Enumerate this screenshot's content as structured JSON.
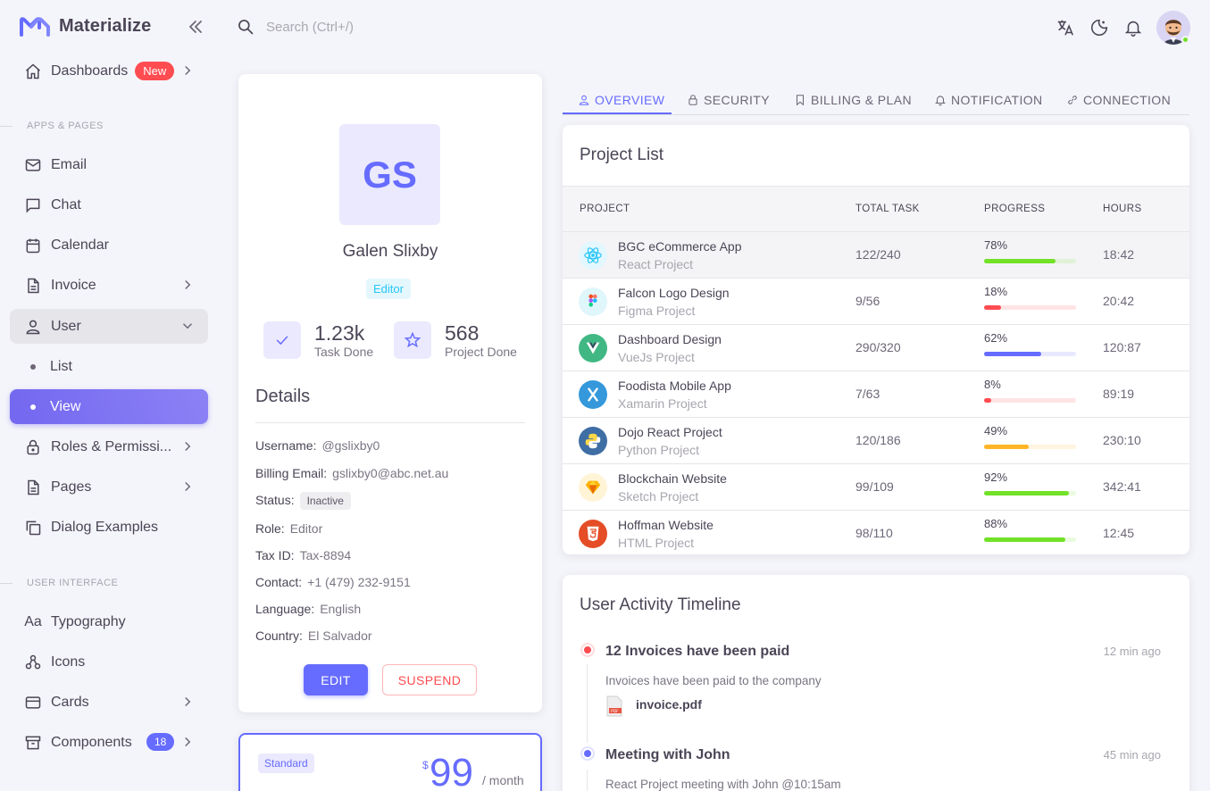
{
  "brand": {
    "name": "Materialize",
    "accent": "#666cff"
  },
  "search": {
    "placeholder": "Search (Ctrl+/)"
  },
  "sidebar": {
    "dashboards": {
      "label": "Dashboards",
      "badge": "New"
    },
    "section_apps": "APPS & PAGES",
    "email": "Email",
    "chat": "Chat",
    "calendar": "Calendar",
    "invoice": "Invoice",
    "user": "User",
    "list": "List",
    "view": "View",
    "roles": "Roles & Permissi...",
    "pages": "Pages",
    "dialogs": "Dialog Examples",
    "section_ui": "USER INTERFACE",
    "typography": "Typography",
    "icons": "Icons",
    "cards": "Cards",
    "components": {
      "label": "Components",
      "badge": "18"
    }
  },
  "profile": {
    "initials": "GS",
    "name": "Galen Slixby",
    "role": "Editor",
    "tasks_done": {
      "value": "1.23k",
      "label": "Task Done"
    },
    "projects_done": {
      "value": "568",
      "label": "Project Done"
    },
    "details_title": "Details",
    "details": [
      {
        "key": "Username:",
        "value": "@gslixby0"
      },
      {
        "key": "Billing Email:",
        "value": "gslixby0@abc.net.au"
      },
      {
        "key": "Status:",
        "value": "Inactive"
      },
      {
        "key": "Role:",
        "value": "Editor"
      },
      {
        "key": "Tax ID:",
        "value": "Tax-8894"
      },
      {
        "key": "Contact:",
        "value": "+1 (479) 232-9151"
      },
      {
        "key": "Language:",
        "value": "English"
      },
      {
        "key": "Country:",
        "value": "El Salvador"
      }
    ],
    "edit_label": "EDIT",
    "suspend_label": "SUSPEND"
  },
  "plan": {
    "chip": "Standard",
    "currency": "$",
    "price": "99",
    "period": "/ month"
  },
  "tabs": [
    "OVERVIEW",
    "SECURITY",
    "BILLING & PLAN",
    "NOTIFICATION",
    "CONNECTION"
  ],
  "projects": {
    "title": "Project List",
    "headers": [
      "PROJECT",
      "TOTAL TASK",
      "PROGRESS",
      "HOURS"
    ],
    "rows": [
      {
        "name": "BGC eCommerce App",
        "sub": "React Project",
        "task": "122/240",
        "progress": "78%",
        "progress_value": 0.78,
        "hours": "18:42",
        "color": "#72e128",
        "icon": "react-icon"
      },
      {
        "name": "Falcon Logo Design",
        "sub": "Figma Project",
        "task": "9/56",
        "progress": "18%",
        "progress_value": 0.18,
        "hours": "20:42",
        "color": "#ff4c51",
        "icon": "figma-icon"
      },
      {
        "name": "Dashboard Design",
        "sub": "VueJs Project",
        "task": "290/320",
        "progress": "62%",
        "progress_value": 0.62,
        "hours": "120:87",
        "color": "#666cff",
        "icon": "vue-icon"
      },
      {
        "name": "Foodista Mobile App",
        "sub": "Xamarin Project",
        "task": "7/63",
        "progress": "8%",
        "progress_value": 0.08,
        "hours": "89:19",
        "color": "#ff4c51",
        "icon": "xamarin-icon"
      },
      {
        "name": "Dojo React Project",
        "sub": "Python Project",
        "task": "120/186",
        "progress": "49%",
        "progress_value": 0.49,
        "hours": "230:10",
        "color": "#fdb528",
        "icon": "python-icon"
      },
      {
        "name": "Blockchain Website",
        "sub": "Sketch Project",
        "task": "99/109",
        "progress": "92%",
        "progress_value": 0.92,
        "hours": "342:41",
        "color": "#72e128",
        "icon": "sketch-icon"
      },
      {
        "name": "Hoffman Website",
        "sub": "HTML Project",
        "task": "98/110",
        "progress": "88%",
        "progress_value": 0.88,
        "hours": "12:45",
        "color": "#72e128",
        "icon": "html5-icon"
      }
    ]
  },
  "timeline": {
    "title": "User Activity Timeline",
    "items": [
      {
        "title": "12 Invoices have been paid",
        "time": "12 min ago",
        "desc": "Invoices have been paid to the company",
        "file": "invoice.pdf",
        "color": "#ff4c51"
      },
      {
        "title": "Meeting with John",
        "time": "45 min ago",
        "desc": "React Project meeting with John @10:15am",
        "color": "#666cff"
      }
    ]
  }
}
